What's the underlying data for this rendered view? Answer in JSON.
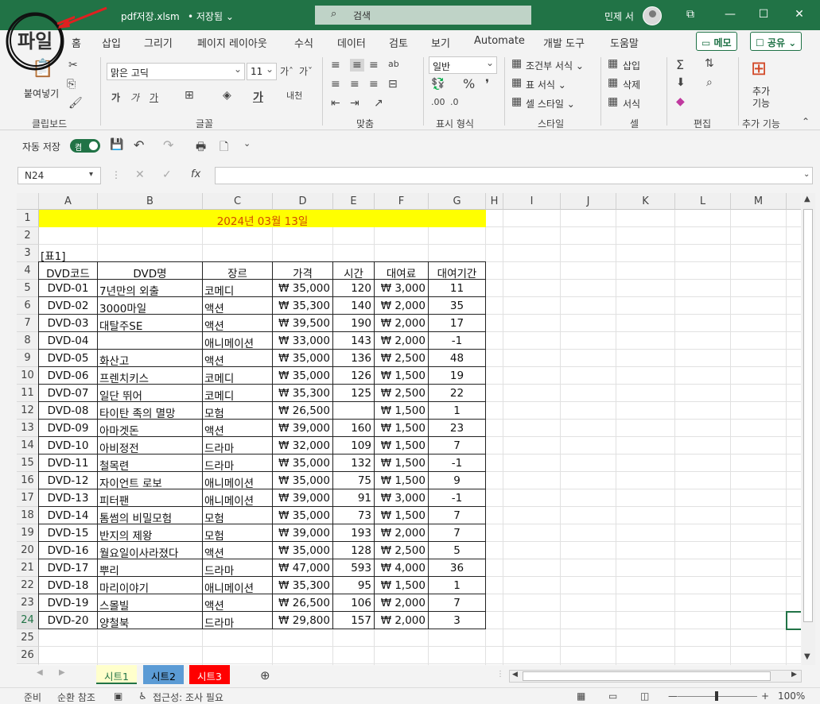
{
  "titlebar": {
    "filename": "pdf저장.xlsm",
    "saved": "• 저장됨 ⌄",
    "search_placeholder": "검색",
    "user": "민제 서"
  },
  "annotation": {
    "text": "파일"
  },
  "ribbon_tabs": [
    "홈",
    "삽입",
    "그리기",
    "페이지 레이아웃",
    "수식",
    "데이터",
    "검토",
    "보기",
    "Automate",
    "개발 도구",
    "도움말"
  ],
  "memo_btn": "▭ 메모",
  "share_btn": "☐ 공유 ⌄",
  "ribbon": {
    "paste": "붙여넣기",
    "font_name": "맑은 고딕",
    "font_size": "11",
    "number_format": "일반",
    "cond_format": "조건부 서식 ⌄",
    "table_format": "표 서식 ⌄",
    "cell_style": "셀 스타일 ⌄",
    "insert": "삽입",
    "delete": "삭제",
    "format": "서식",
    "addins": "추가\n기능",
    "groups": {
      "clipboard": "클립보드",
      "font": "글꼴",
      "align": "맞춤",
      "number": "표시 형식",
      "style": "스타일",
      "cells": "셀",
      "edit": "편집",
      "addin": "추가 기능"
    }
  },
  "qat": {
    "autosave": "자동 저장",
    "toggle": "켬"
  },
  "namebox": "N24",
  "columns": [
    "A",
    "B",
    "C",
    "D",
    "E",
    "F",
    "G",
    "H",
    "I",
    "J",
    "K",
    "L",
    "M"
  ],
  "rows": [
    "1",
    "2",
    "3",
    "4",
    "5",
    "6",
    "7",
    "8",
    "9",
    "10",
    "11",
    "12",
    "13",
    "14",
    "15",
    "16",
    "17",
    "18",
    "19",
    "20",
    "21",
    "22",
    "23",
    "24",
    "25",
    "26"
  ],
  "sheet": {
    "banner": "2024년 03월 13일",
    "table_label": "[표1]",
    "headers": [
      "DVD코드",
      "DVD명",
      "장르",
      "가격",
      "시간",
      "대여료",
      "대여기간"
    ],
    "data": [
      [
        "DVD-01",
        "7년만의 외출",
        "코메디",
        "₩ 35,000",
        "120",
        "₩ 3,000",
        "11"
      ],
      [
        "DVD-02",
        "3000마일",
        "액션",
        "₩ 35,300",
        "140",
        "₩ 2,000",
        "35"
      ],
      [
        "DVD-03",
        "대탈주SE",
        "액션",
        "₩ 39,500",
        "190",
        "₩ 2,000",
        "17"
      ],
      [
        "DVD-04",
        "",
        "애니메이션",
        "₩ 33,000",
        "143",
        "₩ 2,000",
        "-1"
      ],
      [
        "DVD-05",
        "화산고",
        "액션",
        "₩ 35,000",
        "136",
        "₩ 2,500",
        "48"
      ],
      [
        "DVD-06",
        "프렌치키스",
        "코메디",
        "₩ 35,000",
        "126",
        "₩ 1,500",
        "19"
      ],
      [
        "DVD-07",
        "일단 뛰어",
        "코메디",
        "₩ 35,300",
        "125",
        "₩ 2,500",
        "22"
      ],
      [
        "DVD-08",
        "타이탄 족의 멸망",
        "모험",
        "₩ 26,500",
        "",
        "₩ 1,500",
        "1"
      ],
      [
        "DVD-09",
        "아마겟돈",
        "액션",
        "₩ 39,000",
        "160",
        "₩ 1,500",
        "23"
      ],
      [
        "DVD-10",
        "아비정전",
        "드라마",
        "₩ 32,000",
        "109",
        "₩ 1,500",
        "7"
      ],
      [
        "DVD-11",
        "철목련",
        "드라마",
        "₩ 35,000",
        "132",
        "₩ 1,500",
        "-1"
      ],
      [
        "DVD-12",
        "자이언트 로보",
        "애니메이션",
        "₩ 35,000",
        "75",
        "₩ 1,500",
        "9"
      ],
      [
        "DVD-13",
        "피터팬",
        "애니메이션",
        "₩ 39,000",
        "91",
        "₩ 3,000",
        "-1"
      ],
      [
        "DVD-14",
        "톰썸의 비밀모험",
        "모험",
        "₩ 35,000",
        "73",
        "₩ 1,500",
        "7"
      ],
      [
        "DVD-15",
        "반지의 제왕",
        "모험",
        "₩ 39,000",
        "193",
        "₩ 2,000",
        "7"
      ],
      [
        "DVD-16",
        "월요일이사라졌다",
        "액션",
        "₩ 35,000",
        "128",
        "₩ 2,500",
        "5"
      ],
      [
        "DVD-17",
        "뿌리",
        "드라마",
        "₩ 47,000",
        "593",
        "₩ 4,000",
        "36"
      ],
      [
        "DVD-18",
        "마리이야기",
        "애니메이션",
        "₩ 35,300",
        "95",
        "₩ 1,500",
        "1"
      ],
      [
        "DVD-19",
        "스몰빌",
        "액션",
        "₩ 26,500",
        "106",
        "₩ 2,000",
        "7"
      ],
      [
        "DVD-20",
        "양철북",
        "드라마",
        "₩ 29,800",
        "157",
        "₩ 2,000",
        "3"
      ]
    ]
  },
  "sheet_tabs": [
    {
      "label": "시트1",
      "bg": "#ffffcc",
      "color": "#217346"
    },
    {
      "label": "시트2",
      "bg": "#5b9bd5",
      "color": "#000000"
    },
    {
      "label": "시트3",
      "bg": "#ff0000",
      "color": "#ffffff"
    }
  ],
  "status": {
    "ready": "준비",
    "circular": "순환 참조",
    "access": "접근성: 조사 필요",
    "zoom": "100%"
  }
}
